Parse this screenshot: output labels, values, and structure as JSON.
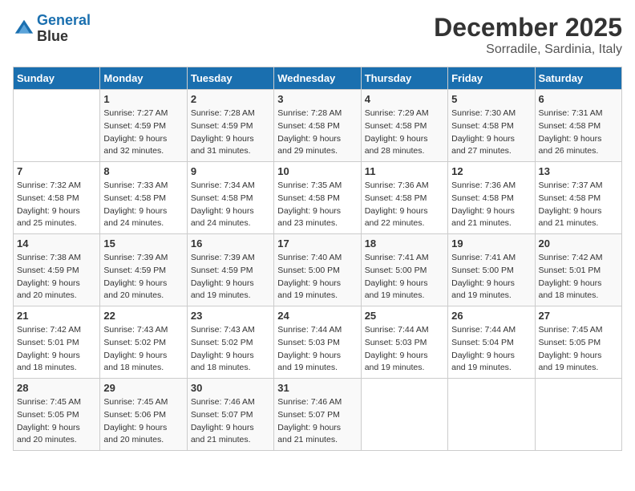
{
  "header": {
    "logo_line1": "General",
    "logo_line2": "Blue",
    "title": "December 2025",
    "subtitle": "Sorradile, Sardinia, Italy"
  },
  "calendar": {
    "days_of_week": [
      "Sunday",
      "Monday",
      "Tuesday",
      "Wednesday",
      "Thursday",
      "Friday",
      "Saturday"
    ],
    "weeks": [
      [
        {
          "day": "",
          "info": ""
        },
        {
          "day": "1",
          "info": "Sunrise: 7:27 AM\nSunset: 4:59 PM\nDaylight: 9 hours\nand 32 minutes."
        },
        {
          "day": "2",
          "info": "Sunrise: 7:28 AM\nSunset: 4:59 PM\nDaylight: 9 hours\nand 31 minutes."
        },
        {
          "day": "3",
          "info": "Sunrise: 7:28 AM\nSunset: 4:58 PM\nDaylight: 9 hours\nand 29 minutes."
        },
        {
          "day": "4",
          "info": "Sunrise: 7:29 AM\nSunset: 4:58 PM\nDaylight: 9 hours\nand 28 minutes."
        },
        {
          "day": "5",
          "info": "Sunrise: 7:30 AM\nSunset: 4:58 PM\nDaylight: 9 hours\nand 27 minutes."
        },
        {
          "day": "6",
          "info": "Sunrise: 7:31 AM\nSunset: 4:58 PM\nDaylight: 9 hours\nand 26 minutes."
        }
      ],
      [
        {
          "day": "7",
          "info": "Sunrise: 7:32 AM\nSunset: 4:58 PM\nDaylight: 9 hours\nand 25 minutes."
        },
        {
          "day": "8",
          "info": "Sunrise: 7:33 AM\nSunset: 4:58 PM\nDaylight: 9 hours\nand 24 minutes."
        },
        {
          "day": "9",
          "info": "Sunrise: 7:34 AM\nSunset: 4:58 PM\nDaylight: 9 hours\nand 24 minutes."
        },
        {
          "day": "10",
          "info": "Sunrise: 7:35 AM\nSunset: 4:58 PM\nDaylight: 9 hours\nand 23 minutes."
        },
        {
          "day": "11",
          "info": "Sunrise: 7:36 AM\nSunset: 4:58 PM\nDaylight: 9 hours\nand 22 minutes."
        },
        {
          "day": "12",
          "info": "Sunrise: 7:36 AM\nSunset: 4:58 PM\nDaylight: 9 hours\nand 21 minutes."
        },
        {
          "day": "13",
          "info": "Sunrise: 7:37 AM\nSunset: 4:58 PM\nDaylight: 9 hours\nand 21 minutes."
        }
      ],
      [
        {
          "day": "14",
          "info": "Sunrise: 7:38 AM\nSunset: 4:59 PM\nDaylight: 9 hours\nand 20 minutes."
        },
        {
          "day": "15",
          "info": "Sunrise: 7:39 AM\nSunset: 4:59 PM\nDaylight: 9 hours\nand 20 minutes."
        },
        {
          "day": "16",
          "info": "Sunrise: 7:39 AM\nSunset: 4:59 PM\nDaylight: 9 hours\nand 19 minutes."
        },
        {
          "day": "17",
          "info": "Sunrise: 7:40 AM\nSunset: 5:00 PM\nDaylight: 9 hours\nand 19 minutes."
        },
        {
          "day": "18",
          "info": "Sunrise: 7:41 AM\nSunset: 5:00 PM\nDaylight: 9 hours\nand 19 minutes."
        },
        {
          "day": "19",
          "info": "Sunrise: 7:41 AM\nSunset: 5:00 PM\nDaylight: 9 hours\nand 19 minutes."
        },
        {
          "day": "20",
          "info": "Sunrise: 7:42 AM\nSunset: 5:01 PM\nDaylight: 9 hours\nand 18 minutes."
        }
      ],
      [
        {
          "day": "21",
          "info": "Sunrise: 7:42 AM\nSunset: 5:01 PM\nDaylight: 9 hours\nand 18 minutes."
        },
        {
          "day": "22",
          "info": "Sunrise: 7:43 AM\nSunset: 5:02 PM\nDaylight: 9 hours\nand 18 minutes."
        },
        {
          "day": "23",
          "info": "Sunrise: 7:43 AM\nSunset: 5:02 PM\nDaylight: 9 hours\nand 18 minutes."
        },
        {
          "day": "24",
          "info": "Sunrise: 7:44 AM\nSunset: 5:03 PM\nDaylight: 9 hours\nand 19 minutes."
        },
        {
          "day": "25",
          "info": "Sunrise: 7:44 AM\nSunset: 5:03 PM\nDaylight: 9 hours\nand 19 minutes."
        },
        {
          "day": "26",
          "info": "Sunrise: 7:44 AM\nSunset: 5:04 PM\nDaylight: 9 hours\nand 19 minutes."
        },
        {
          "day": "27",
          "info": "Sunrise: 7:45 AM\nSunset: 5:05 PM\nDaylight: 9 hours\nand 19 minutes."
        }
      ],
      [
        {
          "day": "28",
          "info": "Sunrise: 7:45 AM\nSunset: 5:05 PM\nDaylight: 9 hours\nand 20 minutes."
        },
        {
          "day": "29",
          "info": "Sunrise: 7:45 AM\nSunset: 5:06 PM\nDaylight: 9 hours\nand 20 minutes."
        },
        {
          "day": "30",
          "info": "Sunrise: 7:46 AM\nSunset: 5:07 PM\nDaylight: 9 hours\nand 21 minutes."
        },
        {
          "day": "31",
          "info": "Sunrise: 7:46 AM\nSunset: 5:07 PM\nDaylight: 9 hours\nand 21 minutes."
        },
        {
          "day": "",
          "info": ""
        },
        {
          "day": "",
          "info": ""
        },
        {
          "day": "",
          "info": ""
        }
      ]
    ]
  }
}
